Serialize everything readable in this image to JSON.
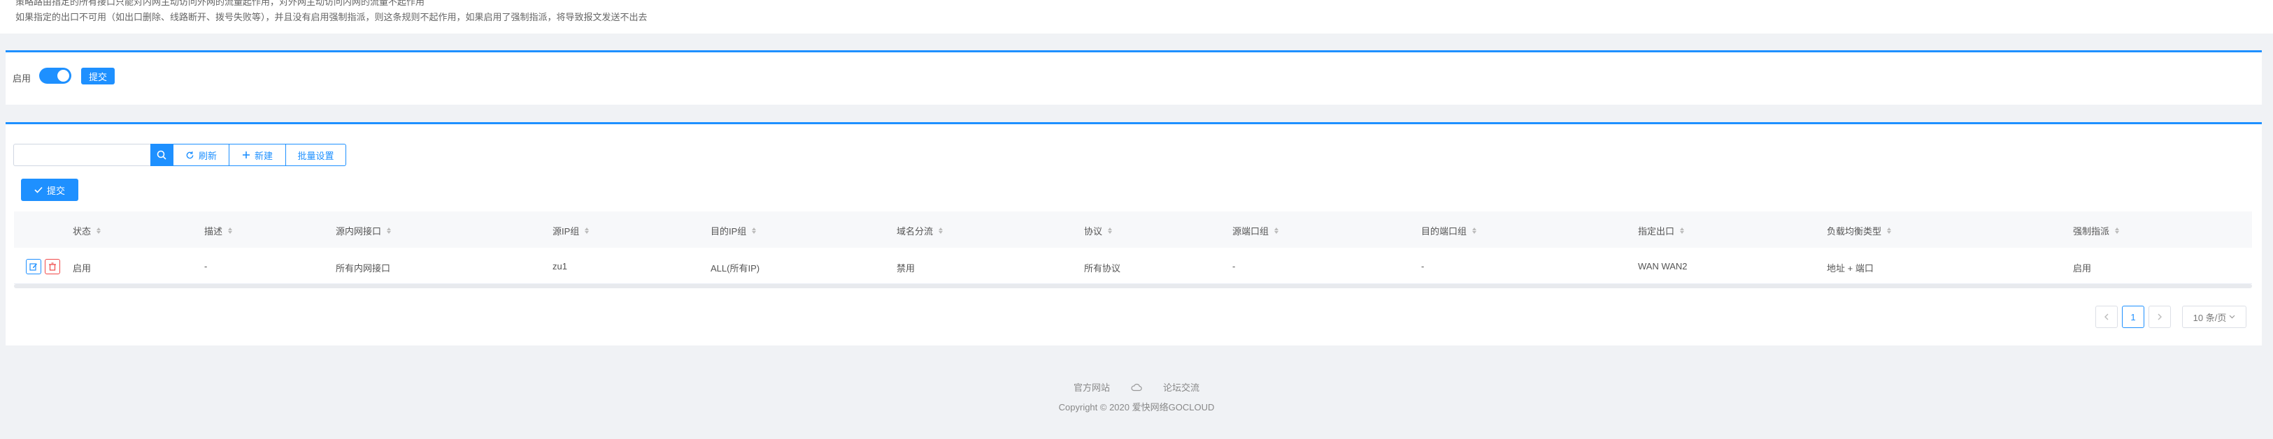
{
  "notice": {
    "line1": "策略路由指定的所有接口只能对内网主动访问外网的流量起作用，对外网主动访问内网的流量不起作用",
    "line2": "如果指定的出口不可用（如出口删除、线路断开、拨号失败等），并且没有启用强制指派，则这条规则不起作用，如果启用了强制指派，将导致报文发送不出去"
  },
  "settings": {
    "enable_label": "启用",
    "toggle_on": true,
    "submit_label": "提交"
  },
  "toolbar": {
    "search_placeholder": "",
    "refresh_label": "刷新",
    "new_label": "新建",
    "batch_label": "批量设置",
    "submit_label": "提交"
  },
  "table": {
    "columns": [
      "状态",
      "描述",
      "源内网接口",
      "源IP组",
      "目的IP组",
      "域名分流",
      "协议",
      "源端口组",
      "目的端口组",
      "指定出口",
      "负载均衡类型",
      "强制指派"
    ],
    "rows": [
      [
        "启用",
        "-",
        "所有内网接口",
        "zu1",
        "ALL(所有IP)",
        "禁用",
        "所有协议",
        "-",
        "-",
        "WAN WAN2",
        "地址 + 端口",
        "启用"
      ]
    ]
  },
  "pagination": {
    "current_page": "1",
    "page_size": "10 条/页"
  },
  "footer": {
    "official_site": "官方网站",
    "forum": "论坛交流",
    "copyright": "Copyright © 2020 爱快网络GOCLOUD"
  },
  "colors": {
    "primary": "#1e90ff",
    "danger": "#f04848",
    "background": "#f0f2f5"
  }
}
